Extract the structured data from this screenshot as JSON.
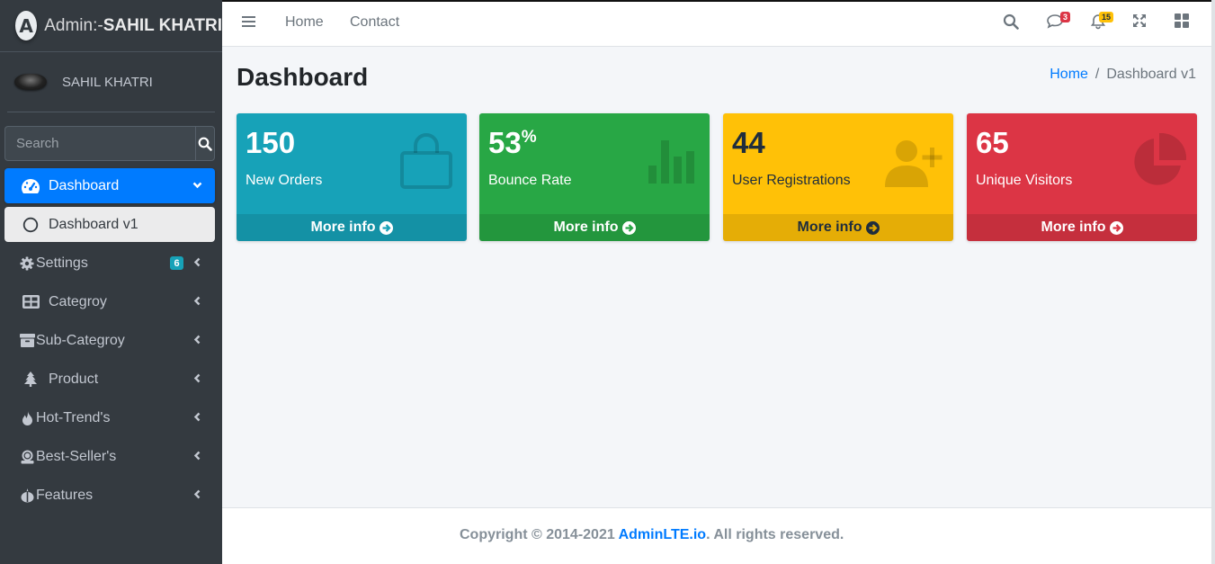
{
  "brand": {
    "prefix": "Admin:-",
    "name": "SAHIL KHATRI",
    "logo_letter": "A"
  },
  "user": {
    "name": "SAHIL KHATRI"
  },
  "search": {
    "placeholder": "Search"
  },
  "sidebar": {
    "items": [
      {
        "label": "Dashboard",
        "icon": "tachometer-icon"
      },
      {
        "label": "Dashboard v1",
        "icon": "circle-icon"
      },
      {
        "label": "Settings",
        "icon": "gear-icon",
        "badge": "6"
      },
      {
        "label": "Categroy",
        "icon": "table-icon"
      },
      {
        "label": "Sub-Categroy",
        "icon": "box-icon"
      },
      {
        "label": "Product",
        "icon": "tree-icon"
      },
      {
        "label": "Hot-Trend's",
        "icon": "fire-icon"
      },
      {
        "label": "Best-Seller's",
        "icon": "award-icon"
      },
      {
        "label": "Features",
        "icon": "jedi-icon"
      }
    ]
  },
  "topbar": {
    "links": [
      "Home",
      "Contact"
    ],
    "messages_count": "3",
    "notifications_count": "15"
  },
  "page": {
    "title": "Dashboard",
    "breadcrumb": [
      "Home",
      "Dashboard v1"
    ]
  },
  "boxes": [
    {
      "value": "150",
      "suffix": "",
      "label": "New Orders",
      "link": "More info",
      "color": "#17a2b8",
      "icon": "shopping-bag-icon"
    },
    {
      "value": "53",
      "suffix": "%",
      "label": "Bounce Rate",
      "link": "More info",
      "color": "#28a745",
      "icon": "bar-chart-icon"
    },
    {
      "value": "44",
      "suffix": "",
      "label": "User Registrations",
      "link": "More info",
      "color": "#ffc107",
      "icon": "user-plus-icon"
    },
    {
      "value": "65",
      "suffix": "",
      "label": "Unique Visitors",
      "link": "More info",
      "color": "#dc3545",
      "icon": "pie-chart-icon"
    }
  ],
  "footer": {
    "text": "Copyright © 2014-2021 ",
    "link": "AdminLTE.io",
    "suffix": ". All rights reserved."
  }
}
